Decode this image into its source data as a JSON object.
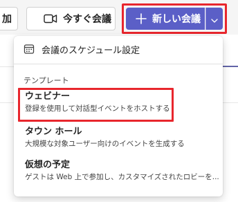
{
  "toolbar": {
    "partial_button_label": "加",
    "meet_now_label": "今すぐ会議",
    "new_meeting_label": "新しい会議"
  },
  "menu": {
    "schedule_label": "会議のスケジュール設定",
    "section_label": "テンプレート",
    "items": [
      {
        "title": "ウェビナー",
        "description": "登録を使用して対話型イベントをホストする"
      },
      {
        "title": "タウン ホール",
        "description": "大規模な対象ユーザー向けのイベントを生成する"
      },
      {
        "title": "仮想の予定",
        "description": "ゲストは Web 上で参加し、カスタマイズされたロビーを..."
      }
    ]
  },
  "colors": {
    "accent": "#5b5fc7",
    "highlight": "#e8262d"
  },
  "icons": [
    "video-icon",
    "plus-icon",
    "chevron-down-icon",
    "calendar-icon"
  ]
}
